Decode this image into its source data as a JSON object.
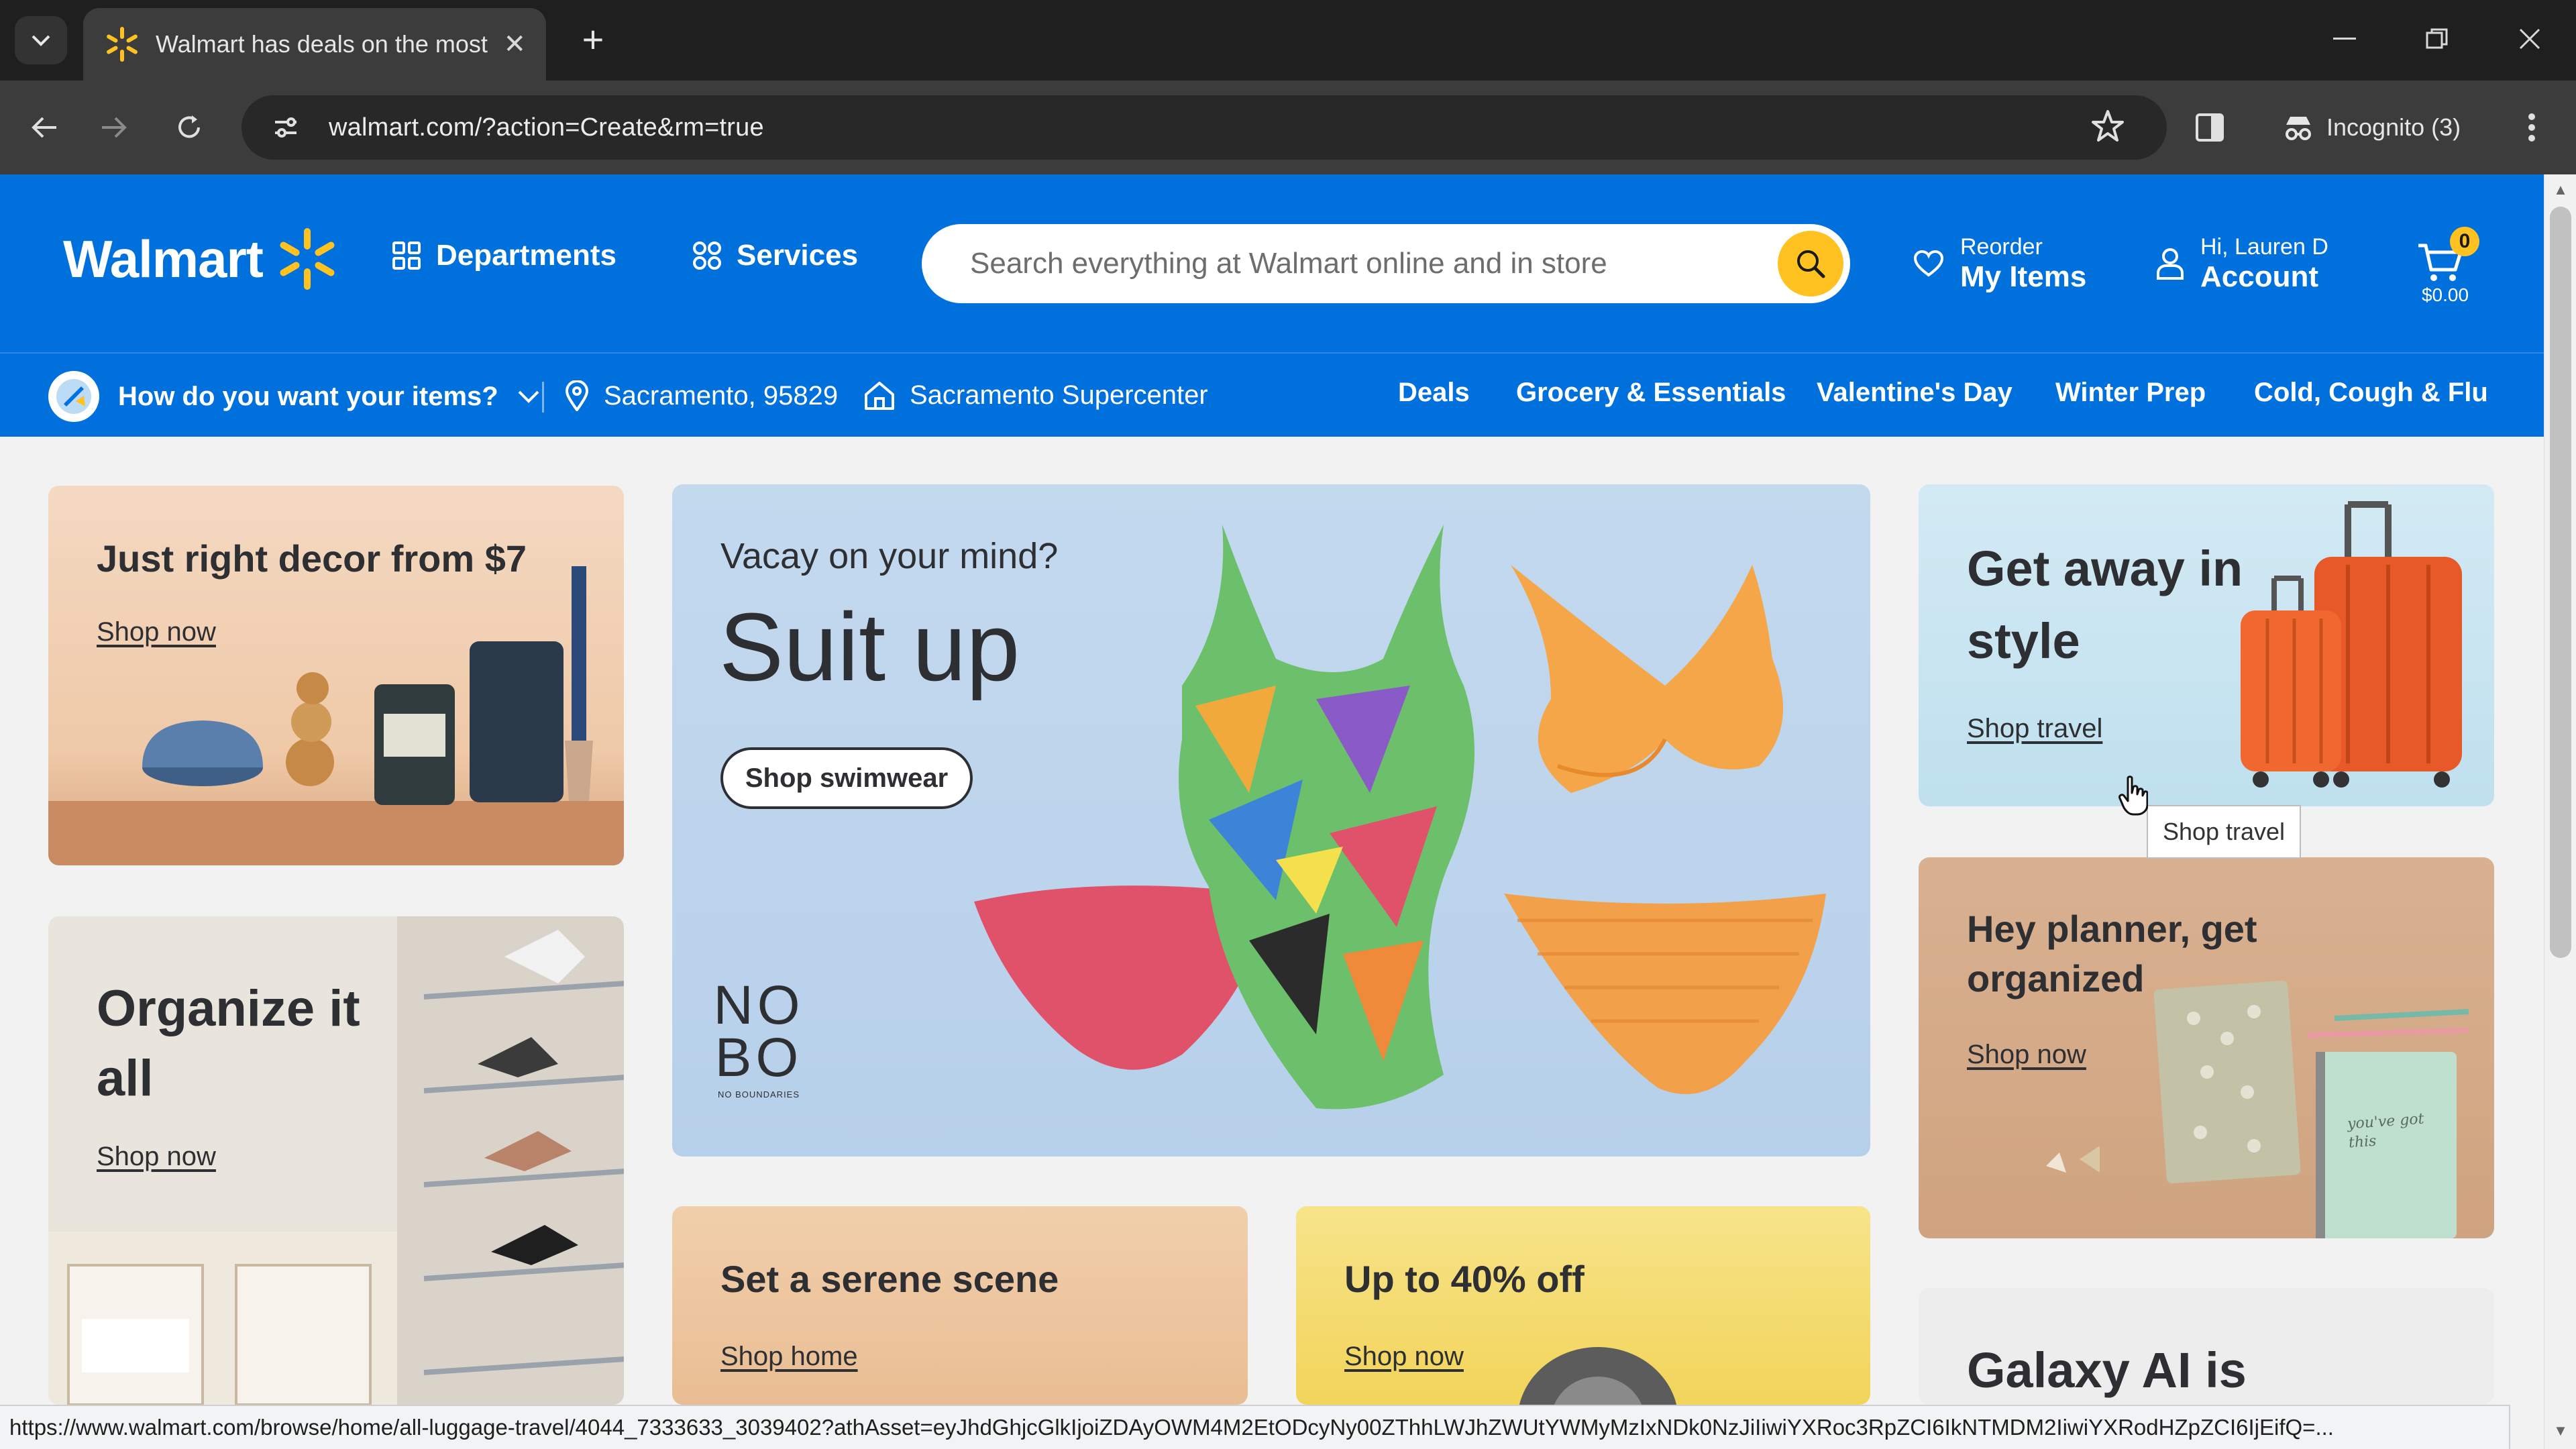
{
  "browser": {
    "tab_title": "Walmart has deals on the most",
    "url": "walmart.com/?action=Create&rm=true",
    "incognito_label": "Incognito (3)",
    "status_url": "https://www.walmart.com/browse/home/all-luggage-travel/4044_7333633_3039402?athAsset=eyJhdGhjcGlkIjoiZDAyOWM4M2EtODcyNy00ZThhLWJhZWUtYWMyMzIxNDk0NzJiIiwiYXRoc3RpZCI6IkNTMDM2IiwiYXRodHZpZCI6IjEifQ=..."
  },
  "header": {
    "logo_text": "Walmart",
    "departments_label": "Departments",
    "services_label": "Services",
    "search_placeholder": "Search everything at Walmart online and in store",
    "reorder_small": "Reorder",
    "reorder_big": "My Items",
    "account_small": "Hi, Lauren D",
    "account_big": "Account",
    "cart_count": "0",
    "cart_total": "$0.00"
  },
  "subnav": {
    "fulfillment_label": "How do you want your items?",
    "location": "Sacramento, 95829",
    "store": "Sacramento Supercenter",
    "categories": [
      "Deals",
      "Grocery & Essentials",
      "Valentine's Day",
      "Winter Prep",
      "Cold, Cough & Flu"
    ]
  },
  "cards": {
    "decor": {
      "title": "Just right decor from $7",
      "link": "Shop now"
    },
    "hero": {
      "eyebrow": "Vacay on your mind?",
      "title": "Suit up",
      "button": "Shop swimwear",
      "brand_line1": "NO",
      "brand_line2": "BO",
      "brand_sub": "NO BOUNDARIES"
    },
    "travel": {
      "title": "Get away in style",
      "link": "Shop travel"
    },
    "organize": {
      "title": "Organize it all",
      "link": "Shop now"
    },
    "planner": {
      "title": "Hey planner, get organized",
      "link": "Shop now"
    },
    "serene": {
      "title": "Set a serene scene",
      "link": "Shop home"
    },
    "sale": {
      "title": "Up to 40% off",
      "link": "Shop now"
    },
    "galaxy": {
      "title": "Galaxy AI is"
    },
    "planner_note": "you've got this"
  },
  "tooltip": "Shop travel",
  "colors": {
    "walmart_blue": "#0071dc",
    "spark_yellow": "#ffc220"
  }
}
